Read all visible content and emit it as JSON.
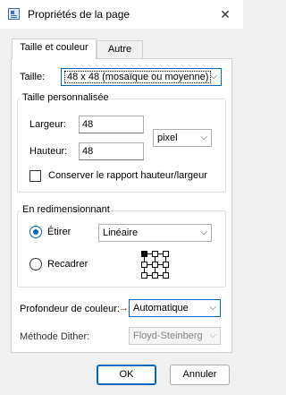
{
  "window": {
    "title": "Propriétés de la page"
  },
  "tabs": [
    {
      "label": "Taille et couleur",
      "active": true
    },
    {
      "label": "Autre",
      "active": false
    }
  ],
  "size": {
    "label": "Taille:",
    "value": "48 x 48 (mosaïque ou moyenne)"
  },
  "custom_size": {
    "group_title": "Taille personnalisée",
    "width_label": "Largeur:",
    "width_value": "48",
    "height_label": "Hauteur:",
    "height_value": "48",
    "unit": "pixel",
    "keep_ratio_label": "Conserver le rapport hauteur/largeur",
    "keep_ratio_checked": false
  },
  "resize": {
    "group_title": "En redimensionnant",
    "stretch_label": "Étirer",
    "stretch_selected": true,
    "method": "Linéaire",
    "crop_label": "Recadrer",
    "crop_selected": false
  },
  "color_depth": {
    "label": "Profondeur de couleur:",
    "value": "Automatique"
  },
  "dither": {
    "label": "Méthode Dither:",
    "value": "Floyd-Steinberg"
  },
  "buttons": {
    "ok": "OK",
    "cancel": "Annuler",
    "close_glyph": "✕"
  },
  "colors": {
    "accent": "#0067c0",
    "arrow": "#e00000"
  }
}
